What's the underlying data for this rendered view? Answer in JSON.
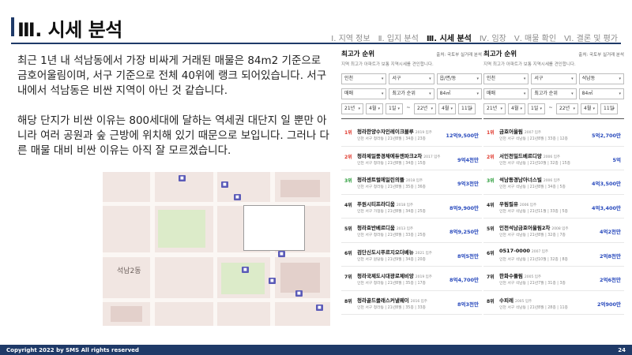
{
  "page": {
    "title": "Ⅲ. 시세 분석",
    "nav": [
      "Ⅰ. 지역 정보",
      "Ⅱ. 입지 분석",
      "Ⅲ. 시세 분석",
      "Ⅳ. 임장",
      "Ⅴ. 매물 확인",
      "Ⅵ. 결론 및 평가"
    ],
    "nav_active_index": 2,
    "paragraphs": [
      "최근 1년 내 석남동에서 가장 비싸게 거래된 매물은 84m2 기준으로 금호어울림이며, 서구 기준으로 전체 40위에 랭크 되어있습니다. 서구 내에서 석남동은 비싼 지역이 아닌 것 같습니다.",
      "해당 단지가 비싼 이유는 800세대에 달하는 역세권 대단지 일 뿐만 아니라 여러 공원과 숲 근방에 위치해 있기 때문으로 보입니다. 그러나 다른 매물 대비 비싼 이유는 아직 잘 모르겠습니다."
    ],
    "footer_copyright": "Copyright 2022 by SMS All rights reserved",
    "page_number": "24"
  },
  "map": {
    "area_label": "석남2동"
  },
  "panels": [
    {
      "title": "최고가 순위",
      "source": "출처: 국토부 실거래 분석",
      "desc": "지역 최고가 아파트가 보통 지역시세를 견인합니다.",
      "region": [
        "인천",
        "서구",
        "읍/면/동"
      ],
      "sort": [
        "매매",
        "최고가 순위",
        "84㎡"
      ],
      "period": [
        "21년",
        "4월",
        "1일",
        "~",
        "22년",
        "4월",
        "11일"
      ],
      "items": [
        {
          "rank": "1위",
          "name": "청라한양수자인레이크블루",
          "built": "2019 입주",
          "meta": "인천 서구 청라동 | 21년8월 | 34층 | 23층",
          "price": "12억9,500만",
          "tier": "hot"
        },
        {
          "rank": "2위",
          "name": "청라제일풍경채에듀앤파크2차",
          "built": "2017 입주",
          "meta": "인천 서구 청라동 | 21년8월 | 34층 | 15층",
          "price": "9억4천만",
          "tier": "hot"
        },
        {
          "rank": "3위",
          "name": "청라센트럴에일린의뜰",
          "built": "2018 입주",
          "meta": "인천 서구 청라동 | 21년8월 | 35층 | 36층",
          "price": "9억3천만",
          "tier": "mid"
        },
        {
          "rank": "4위",
          "name": "푸원시티프라디움",
          "built": "2018 입주",
          "meta": "인천 서구 가정동 | 21년8월 | 34층 | 25층",
          "price": "8억9,900만",
          "tier": "cold"
        },
        {
          "rank": "5위",
          "name": "청라호반베르디움",
          "built": "2013 입주",
          "meta": "인천 서구 청라동 | 21년8월 | 33층 | 25층",
          "price": "8억9,250만",
          "tier": "cold"
        },
        {
          "rank": "6위",
          "name": "검단신도시푸르지오더베뉴",
          "built": "2021 입주",
          "meta": "인천 서구 원당동 | 21년9월 | 34층 | 20층",
          "price": "8억5천만",
          "tier": "cold"
        },
        {
          "rank": "7위",
          "name": "청라국제도시대광로제비앙",
          "built": "2019 입주",
          "meta": "인천 서구 청라동 | 21년8월 | 35층 | 17층",
          "price": "8억4,700만",
          "tier": "cold"
        },
        {
          "rank": "8위",
          "name": "청라골드클래스커낼웨이",
          "built": "2016 입주",
          "meta": "인천 서구 청라동 | 21년8월 | 35층 | 33층",
          "price": "8억3천만",
          "tier": "cold"
        }
      ]
    },
    {
      "title": "최고가 순위",
      "source": "출처: 국토부 실거래 분석",
      "desc": "지역 최고가 아파트가 보통 지역시세를 견인합니다.",
      "region": [
        "인천",
        "서구",
        "석남동"
      ],
      "sort": [
        "매매",
        "최고가 순위",
        "84㎡"
      ],
      "period": [
        "21년",
        "4월",
        "1일",
        "~",
        "22년",
        "4월",
        "11일"
      ],
      "items": [
        {
          "rank": "1위",
          "name": "금호어울림",
          "built": "2007 입주",
          "meta": "인천 서구 석남동 | 21년8월 | 33층 | 12층",
          "price": "5억2,700만",
          "tier": "hot"
        },
        {
          "rank": "2위",
          "name": "서인천밀드베르디앙",
          "built": "2006 입주",
          "meta": "인천 서구 석남동 | 21년10월 | 32층 | 15층",
          "price": "5억",
          "tier": "hot"
        },
        {
          "rank": "3위",
          "name": "석남동경남아너스빌",
          "built": "2006 입주",
          "meta": "인천 서구 석남동 | 21년8월 | 34층 | 5층",
          "price": "4억3,500만",
          "tier": "mid"
        },
        {
          "rank": "4위",
          "name": "우림필유",
          "built": "2006 입주",
          "meta": "인천 서구 석남동 | 21년11월 | 33층 | 5층",
          "price": "4억3,400만",
          "tier": "cold"
        },
        {
          "rank": "5위",
          "name": "인천석남금호어울림2차",
          "built": "2008 입주",
          "meta": "인천 서구 석남동 | 21년8월 | 32층 | 7층",
          "price": "4억2천만",
          "tier": "cold"
        },
        {
          "rank": "6위",
          "name": "0517-0000",
          "built": "2007 입주",
          "meta": "인천 서구 석남동 | 21년10월 | 32층 | 8층",
          "price": "2억8천만",
          "tier": "cold"
        },
        {
          "rank": "7위",
          "name": "한화수풀림",
          "built": "2005 입주",
          "meta": "인천 서구 석남동 | 21년7월 | 31층 | 3층",
          "price": "2억6천만",
          "tier": "cold"
        },
        {
          "rank": "8위",
          "name": "수피레",
          "built": "2005 입주",
          "meta": "인천 서구 석남동 | 21년8월 | 28층 | 11층",
          "price": "2억900만",
          "tier": "cold"
        }
      ]
    }
  ],
  "colors": {
    "brand": "#1f3a68",
    "rank_hot": "#e03a2e",
    "rank_mid": "#2a9d3a",
    "price": "#2a4bbd",
    "map_marker": "#5b5bb8"
  }
}
